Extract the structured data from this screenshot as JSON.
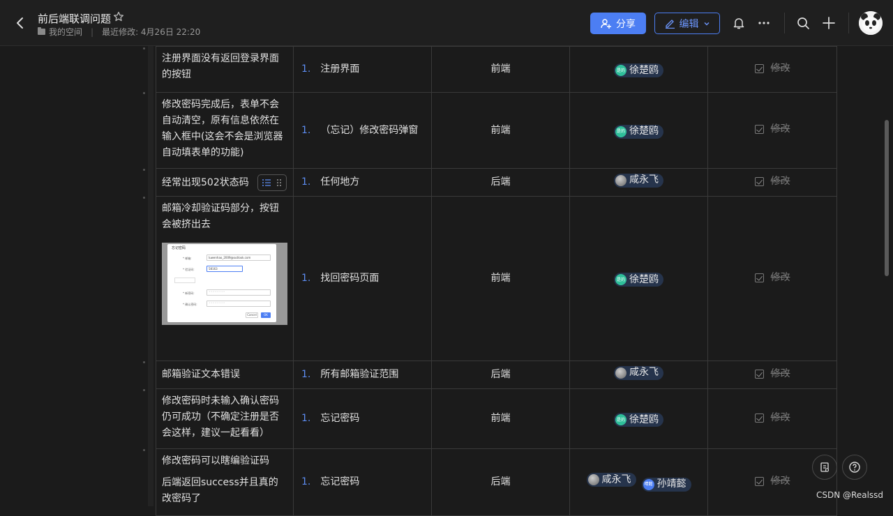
{
  "header": {
    "title": "前后端联调问题",
    "breadcrumb_space": "我的空间",
    "last_modified": "最近修改: 4月26日 22:20",
    "share_label": "分享",
    "edit_label": "编辑"
  },
  "rows": [
    {
      "issue": "注册界面没有返回登录界面的按钮",
      "idx": "1.",
      "location": "注册界面",
      "side": "前端",
      "assignees": [
        {
          "avatar": "是的",
          "name": "徐楚鸥"
        }
      ],
      "status": "修改"
    },
    {
      "issue": "修改密码完成后，表单不会自动清空，原有信息依然在输入框中(这会不会是浏览器自动填表单的功能)",
      "idx": "1.",
      "location": "（忘记）修改密码弹窗",
      "side": "前端",
      "assignees": [
        {
          "avatar": "是的",
          "name": "徐楚鸥"
        }
      ],
      "status": "修改"
    },
    {
      "issue": "经常出现502状态码",
      "idx": "1.",
      "location": "任何地方",
      "side": "后端",
      "assignees": [
        {
          "avatar": "",
          "name": "咸永飞"
        }
      ],
      "status": "修改"
    },
    {
      "issue": "邮箱冷却验证码部分，按钮会被挤出去",
      "idx": "1.",
      "location": "找回密码页面",
      "side": "前端",
      "assignees": [
        {
          "avatar": "是的",
          "name": "徐楚鸥"
        }
      ],
      "status": "修改",
      "screenshot": {
        "title": "忘记密码",
        "email_label": "* 邮箱:",
        "email_value": "luwenhao_2009@outlook.com",
        "code_label": "* 验证码:",
        "code_value": "58163",
        "newpw_label": "* 新密码:",
        "confirm_label": "* 确认密码:",
        "cancel": "Cancel",
        "ok": "OK"
      }
    },
    {
      "issue": "邮箱验证文本错误",
      "idx": "1.",
      "location": "所有邮箱验证范围",
      "side": "后端",
      "assignees": [
        {
          "avatar": "",
          "name": "咸永飞"
        }
      ],
      "status": "修改"
    },
    {
      "issue": "修改密码时未输入确认密码仍可成功（不确定注册是否会这样，建议一起看看）",
      "idx": "1.",
      "location": "忘记密码",
      "side": "前端",
      "assignees": [
        {
          "avatar": "是的",
          "name": "徐楚鸥"
        }
      ],
      "status": "修改"
    },
    {
      "issue": "修改密码可以瞎编验证码",
      "issue2": "后端返回success并且真的改密码了",
      "idx": "1.",
      "location": "忘记密码",
      "side": "后端",
      "assignees": [
        {
          "avatar": "",
          "name": "咸永飞"
        },
        {
          "avatar": "晴懿",
          "name": "孙靖懿"
        }
      ],
      "status": "修改"
    }
  ],
  "watermark": "CSDN @Realssd"
}
